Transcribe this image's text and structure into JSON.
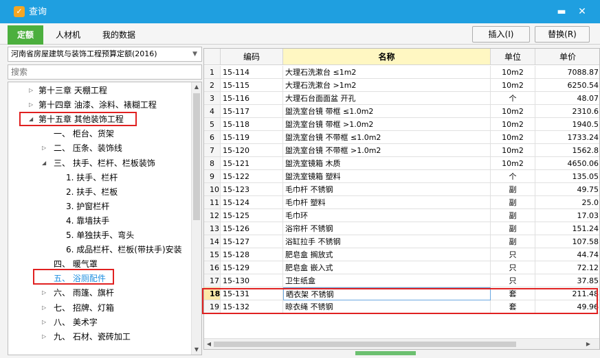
{
  "window": {
    "title": "查询",
    "minimize_glyph": "▬",
    "close_glyph": "✕"
  },
  "tabs": [
    {
      "label": "定额",
      "active": true
    },
    {
      "label": "人材机",
      "active": false
    },
    {
      "label": "我的数据",
      "active": false
    }
  ],
  "buttons": {
    "insert": "插入(I)",
    "replace": "替换(R)"
  },
  "left": {
    "quota_set": "河南省房屋建筑与装饰工程预算定额(2016)",
    "search_placeholder": "搜索",
    "tree": [
      {
        "label": "第十三章  天棚工程",
        "arrow": "▷",
        "level": 0
      },
      {
        "label": "第十四章  油漆、涂料、裱糊工程",
        "arrow": "▷",
        "level": 0
      },
      {
        "label": "第十五章  其他装饰工程",
        "arrow": "◢",
        "level": 0
      },
      {
        "label": "一、 柜台、货架",
        "arrow": "",
        "level": 1
      },
      {
        "label": "二、 压条、装饰线",
        "arrow": "▷",
        "level": 1
      },
      {
        "label": "三、 扶手、栏杆、栏板装饰",
        "arrow": "◢",
        "level": 1
      },
      {
        "label": "1.  扶手、栏杆",
        "arrow": "",
        "level": 2
      },
      {
        "label": "2.  扶手、栏板",
        "arrow": "",
        "level": 2
      },
      {
        "label": "3.  护窗栏杆",
        "arrow": "",
        "level": 2
      },
      {
        "label": "4.  靠墙扶手",
        "arrow": "",
        "level": 2
      },
      {
        "label": "5.  单独扶手、弯头",
        "arrow": "",
        "level": 2
      },
      {
        "label": "6.  成品栏杆、栏板(带扶手)安装",
        "arrow": "",
        "level": 2
      },
      {
        "label": "四、 暖气罩",
        "arrow": "",
        "level": 1
      },
      {
        "label": "五、 浴厕配件",
        "arrow": "",
        "level": 1,
        "selected": true
      },
      {
        "label": "六、 雨篷、旗杆",
        "arrow": "▷",
        "level": 1
      },
      {
        "label": "七、 招牌、灯箱",
        "arrow": "▷",
        "level": 1
      },
      {
        "label": "八、 美术字",
        "arrow": "▷",
        "level": 1
      },
      {
        "label": "九、 石材、瓷砖加工",
        "arrow": "▷",
        "level": 1
      }
    ]
  },
  "table": {
    "columns": {
      "code": "编码",
      "name": "名称",
      "unit": "单位",
      "price": "单价"
    },
    "rows": [
      {
        "idx": "1",
        "code": "15-114",
        "name": "大理石洗漱台  ≤1m2",
        "unit": "10m2",
        "price": "7088.87"
      },
      {
        "idx": "2",
        "code": "15-115",
        "name": "大理石洗漱台  >1m2",
        "unit": "10m2",
        "price": "6250.54"
      },
      {
        "idx": "3",
        "code": "15-116",
        "name": "大理石台面面盆  开孔",
        "unit": "个",
        "price": "48.07"
      },
      {
        "idx": "4",
        "code": "15-117",
        "name": "盥洗室台镜  带框  ≤1.0m2",
        "unit": "10m2",
        "price": "2310.6"
      },
      {
        "idx": "5",
        "code": "15-118",
        "name": "盥洗室台镜  带框  >1.0m2",
        "unit": "10m2",
        "price": "1940.5"
      },
      {
        "idx": "6",
        "code": "15-119",
        "name": "盥洗室台镜  不带框  ≤1.0m2",
        "unit": "10m2",
        "price": "1733.24"
      },
      {
        "idx": "7",
        "code": "15-120",
        "name": "盥洗室台镜  不带框  >1.0m2",
        "unit": "10m2",
        "price": "1562.8"
      },
      {
        "idx": "8",
        "code": "15-121",
        "name": "盥洗室镜箱  木质",
        "unit": "10m2",
        "price": "4650.06"
      },
      {
        "idx": "9",
        "code": "15-122",
        "name": "盥洗室镜箱  塑料",
        "unit": "个",
        "price": "135.05"
      },
      {
        "idx": "10",
        "code": "15-123",
        "name": "毛巾杆  不锈钢",
        "unit": "副",
        "price": "49.75"
      },
      {
        "idx": "11",
        "code": "15-124",
        "name": "毛巾杆  塑料",
        "unit": "副",
        "price": "25.0"
      },
      {
        "idx": "12",
        "code": "15-125",
        "name": "毛巾环",
        "unit": "副",
        "price": "17.03"
      },
      {
        "idx": "13",
        "code": "15-126",
        "name": "浴帘杆  不锈钢",
        "unit": "副",
        "price": "151.24"
      },
      {
        "idx": "14",
        "code": "15-127",
        "name": "浴缸拉手  不锈钢",
        "unit": "副",
        "price": "107.58"
      },
      {
        "idx": "15",
        "code": "15-128",
        "name": "肥皂盒  搁放式",
        "unit": "只",
        "price": "44.74"
      },
      {
        "idx": "16",
        "code": "15-129",
        "name": "肥皂盒  嵌入式",
        "unit": "只",
        "price": "72.12"
      },
      {
        "idx": "17",
        "code": "15-130",
        "name": "卫生纸盒",
        "unit": "只",
        "price": "37.85"
      },
      {
        "idx": "18",
        "code": "15-131",
        "name": "晒衣架  不锈钢",
        "unit": "套",
        "price": "211.48",
        "selected": true
      },
      {
        "idx": "19",
        "code": "15-132",
        "name": "晾衣绳  不锈钢",
        "unit": "套",
        "price": "49.96"
      }
    ]
  },
  "icons": {
    "app": "app-logo-icon",
    "dropdown": "chevron-down-icon",
    "scroll_up": "scroll-up-icon",
    "scroll_down": "scroll-down-icon",
    "scroll_left": "scroll-left-icon",
    "scroll_right": "scroll-right-icon"
  },
  "colors": {
    "titlebar": "#1f9fe0",
    "active_tab": "#4caf3e",
    "highlight": "#e02020",
    "header_name": "#fff7c2"
  }
}
